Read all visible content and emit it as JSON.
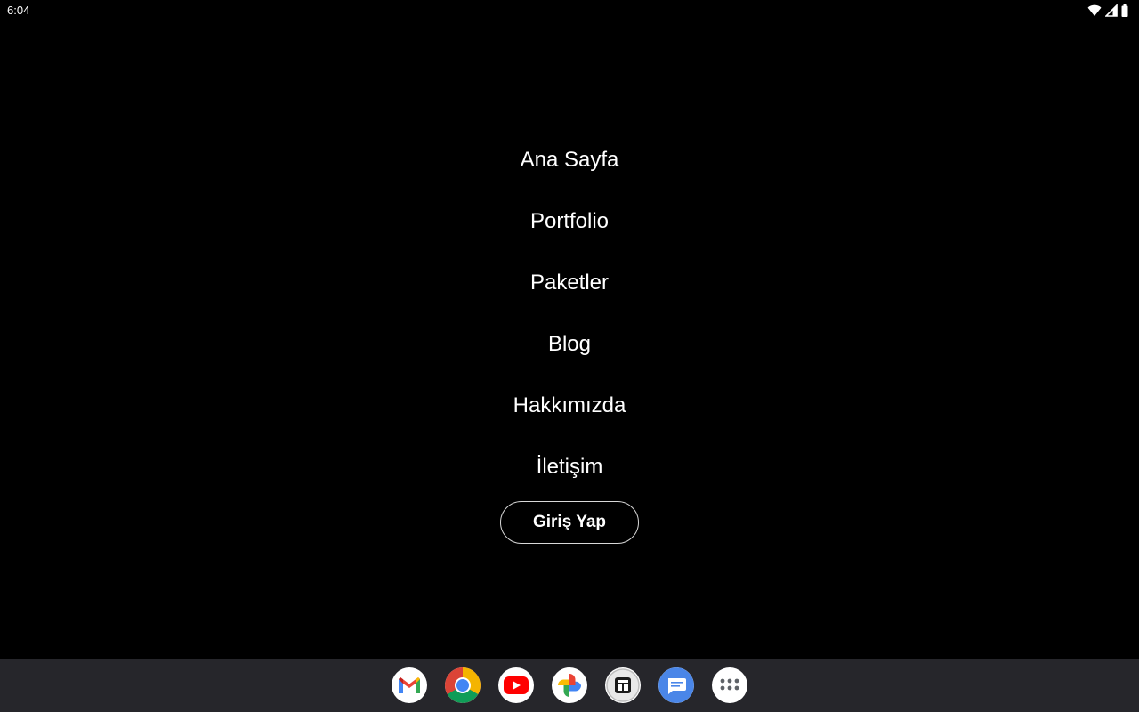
{
  "status_bar": {
    "time": "6:04",
    "icons": [
      "wifi-icon",
      "cellular-signal-icon",
      "battery-icon"
    ]
  },
  "menu": {
    "items": [
      {
        "label": "Ana Sayfa"
      },
      {
        "label": "Portfolio"
      },
      {
        "label": "Paketler"
      },
      {
        "label": "Blog"
      },
      {
        "label": "Hakkımızda"
      },
      {
        "label": "İletişim"
      }
    ],
    "login_label": "Giriş Yap"
  },
  "dock": {
    "apps": [
      {
        "icon": "gmail-icon"
      },
      {
        "icon": "chrome-icon"
      },
      {
        "icon": "youtube-icon"
      },
      {
        "icon": "photos-icon"
      },
      {
        "icon": "store-icon"
      },
      {
        "icon": "messages-icon"
      },
      {
        "icon": "app-drawer-icon"
      }
    ]
  },
  "colors": {
    "background": "#000000",
    "text": "#ffffff",
    "dock_background": "#26262b",
    "button_border": "#d8d8d8"
  }
}
